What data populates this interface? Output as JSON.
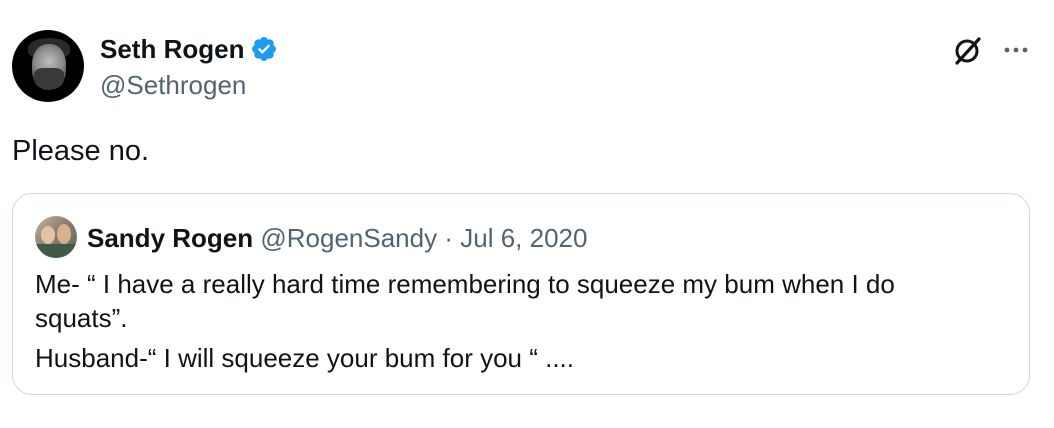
{
  "author": {
    "name": "Seth Rogen",
    "handle": "@Sethrogen",
    "verified": true
  },
  "tweet": {
    "text": "Please no."
  },
  "quoted_tweet": {
    "name": "Sandy Rogen",
    "handle": "@RogenSandy",
    "separator": "·",
    "date": "Jul 6, 2020",
    "lines": [
      "Me- “ I have a really hard time remembering to squeeze my bum when I do",
      "squats”.",
      "Husband-“ I will squeeze your bum for you “ ...."
    ]
  },
  "icons": {
    "verified": "verified-badge-icon",
    "grok": "grok-icon",
    "more": "more-options-icon"
  },
  "colors": {
    "verified": "#1d9bf0",
    "text_primary": "#0f1419",
    "text_secondary": "#536471",
    "border": "#cfd9de"
  }
}
